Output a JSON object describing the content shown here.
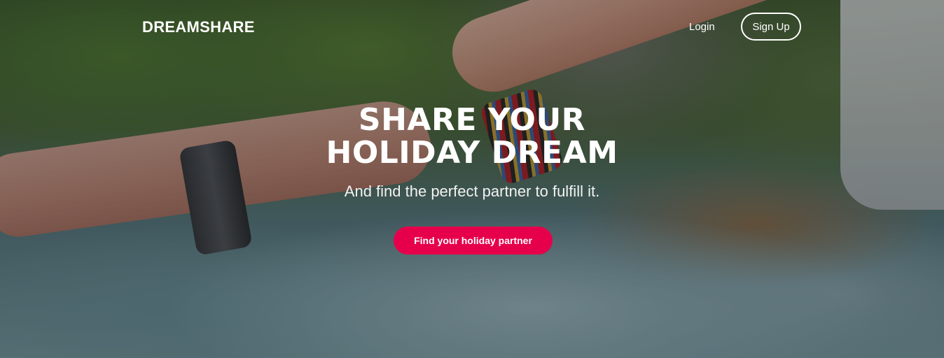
{
  "nav": {
    "brand": "DREAMSHARE",
    "login_label": "Login",
    "signup_label": "Sign Up"
  },
  "hero": {
    "headline_line1": "SHARE YOUR",
    "headline_line2": "HOLIDAY DREAM",
    "subtitle": "And find the perfect partner to fulfill it.",
    "cta_label": "Find your holiday partner"
  },
  "colors": {
    "accent": "#e6004c",
    "text": "#ffffff"
  }
}
